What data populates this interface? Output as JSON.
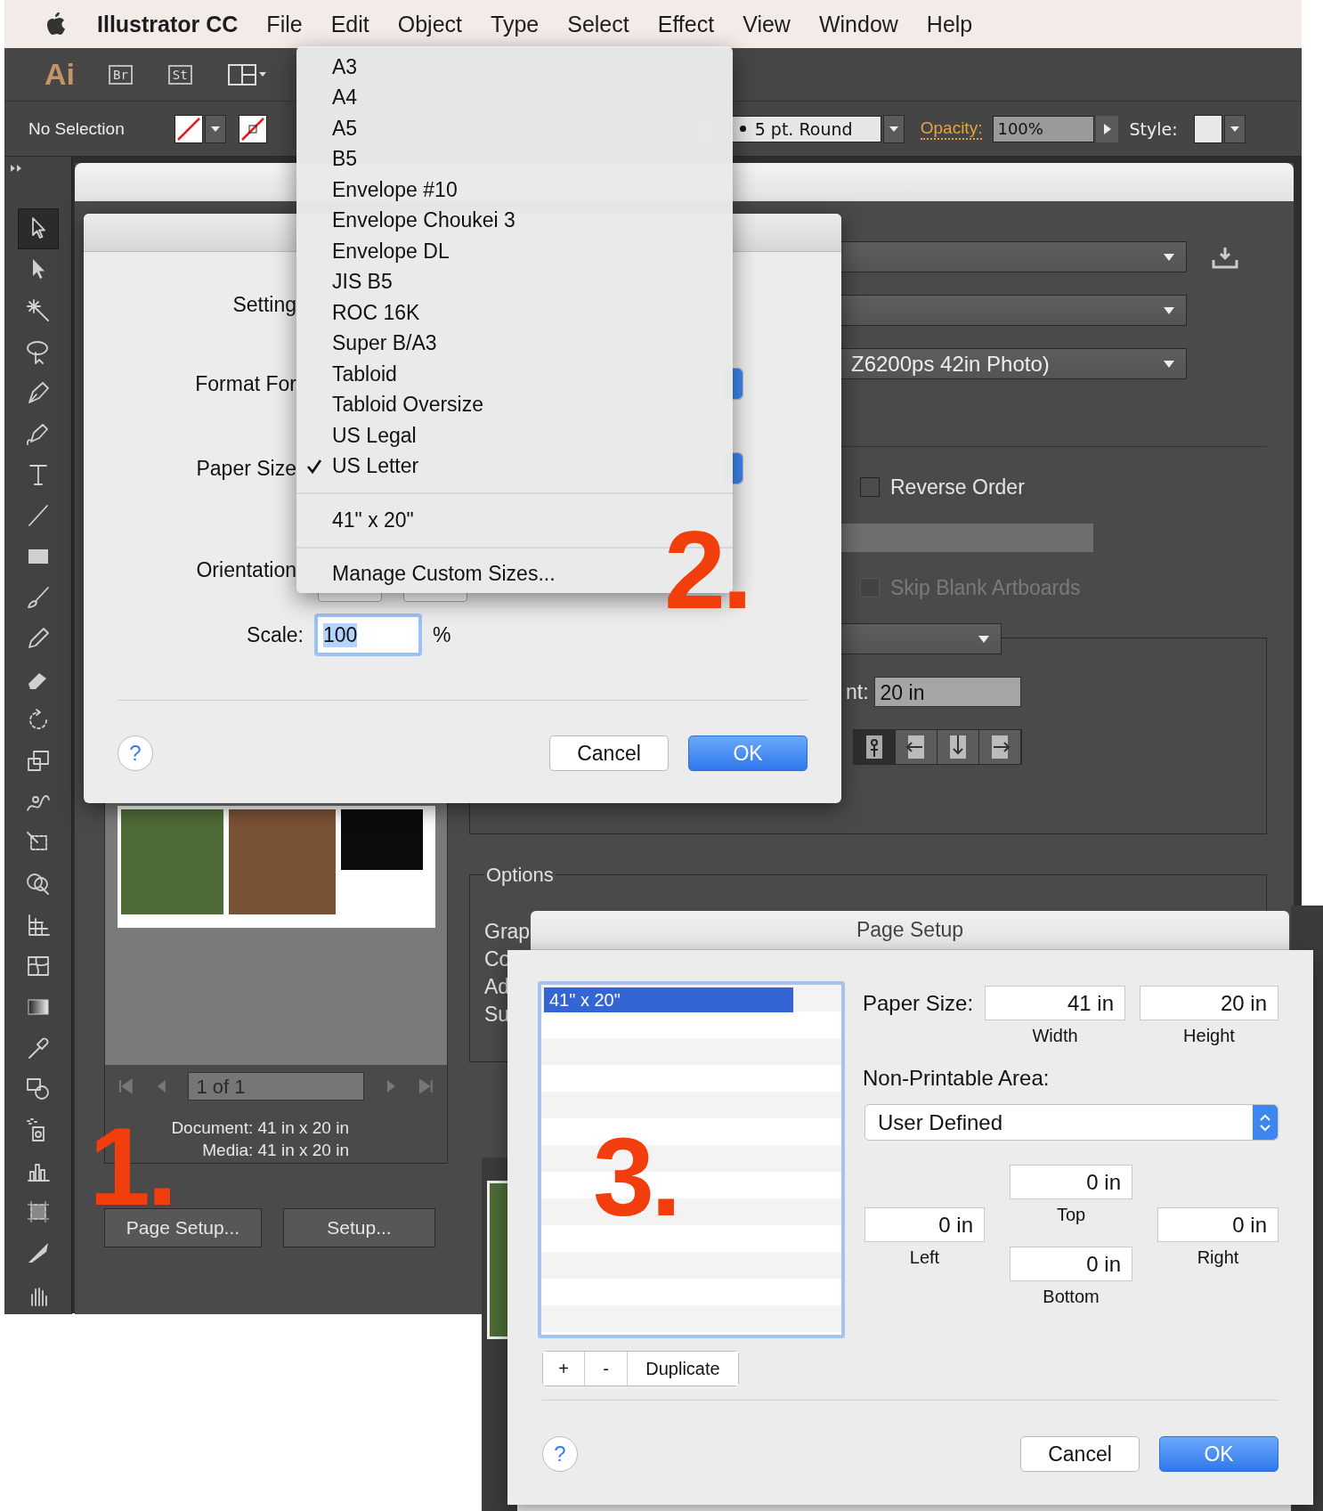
{
  "menu_bar": {
    "app_name": "Illustrator CC",
    "items": [
      "File",
      "Edit",
      "Object",
      "Type",
      "Select",
      "Effect",
      "View",
      "Window",
      "Help"
    ]
  },
  "app_bar": {
    "logo": "Ai",
    "buttons": [
      "Br",
      "St"
    ]
  },
  "control_bar": {
    "selection": "No Selection",
    "stroke": "5 pt. Round",
    "opacity_label": "Opacity:",
    "opacity": "100%",
    "style_label": "Style:"
  },
  "tools": [
    {
      "selected": true
    },
    {
      "selected": false
    },
    {
      "selected": false
    },
    {
      "selected": false
    },
    {
      "selected": false
    },
    {
      "selected": false
    },
    {
      "selected": false
    },
    {
      "selected": false
    },
    {
      "selected": false
    },
    {
      "selected": false
    },
    {
      "selected": false
    },
    {
      "selected": false
    },
    {
      "selected": false
    },
    {
      "selected": false
    },
    {
      "selected": false
    },
    {
      "selected": false
    },
    {
      "selected": false
    },
    {
      "selected": false
    },
    {
      "selected": false
    },
    {
      "selected": false
    },
    {
      "selected": false
    },
    {
      "selected": false
    },
    {
      "selected": false
    },
    {
      "selected": false
    },
    {
      "selected": false
    },
    {
      "selected": false
    },
    {
      "selected": false
    }
  ],
  "print_panel": {
    "printer_fragment": "Z6200ps 42in Photo)",
    "checkboxes": [
      {
        "label": "Reverse Order",
        "checked": false,
        "disabled": false
      },
      {
        "label": "Skip Blank Artboards",
        "checked": false,
        "disabled": true
      }
    ],
    "height_label": "nt:",
    "height_value": "20 in",
    "placement_buttons": [
      {
        "selected": true
      },
      {
        "selected": false
      },
      {
        "selected": false
      },
      {
        "selected": false
      }
    ],
    "options_title": "Options",
    "options_labels": [
      "Grap",
      "Co",
      "Ad",
      "Su"
    ],
    "page_field": "1 of 1",
    "document_size": "Document: 41 in x 20 in",
    "media_size": "Media: 41 in x 20 in",
    "buttons": [
      "Page Setup...",
      "Setup..."
    ]
  },
  "print_dialog": {
    "labels": [
      "Setting",
      "Format For",
      "Paper Size",
      "Orientation"
    ],
    "scale_label": "Scale:",
    "scale_value": "100",
    "scale_unit": "%",
    "help": "?",
    "buttons": [
      {
        "label": "Cancel",
        "default": false
      },
      {
        "label": "OK",
        "default": true
      }
    ]
  },
  "paper_size_menu": {
    "items": [
      {
        "label": "A3",
        "checked": false
      },
      {
        "label": "A4",
        "checked": false
      },
      {
        "label": "A5",
        "checked": false
      },
      {
        "label": "B5",
        "checked": false
      },
      {
        "label": "Envelope #10",
        "checked": false
      },
      {
        "label": "Envelope Choukei 3",
        "checked": false
      },
      {
        "label": "Envelope DL",
        "checked": false
      },
      {
        "label": "JIS B5",
        "checked": false
      },
      {
        "label": "ROC 16K",
        "checked": false
      },
      {
        "label": "Super B/A3",
        "checked": false
      },
      {
        "label": "Tabloid",
        "checked": false
      },
      {
        "label": "Tabloid Oversize",
        "checked": false
      },
      {
        "label": "US Legal",
        "checked": false
      },
      {
        "label": "US Letter",
        "checked": true
      }
    ],
    "custom_sizes": [
      {
        "label": "41\" x 20\"",
        "checked": false
      }
    ],
    "manage": "Manage Custom Sizes..."
  },
  "page_setup": {
    "title": "Page Setup",
    "sizes": [
      {
        "label": "41\" x 20\"",
        "selected": true
      }
    ],
    "list_buttons": [
      "+",
      "-",
      "Duplicate"
    ],
    "paper_size_label": "Paper Size:",
    "width": "41 in",
    "width_label": "Width",
    "height": "20 in",
    "height_label": "Height",
    "non_printable_label": "Non-Printable Area:",
    "non_printable": "User Defined",
    "margins": {
      "top": "0 in",
      "top_label": "Top",
      "left": "0 in",
      "left_label": "Left",
      "right": "0 in",
      "right_label": "Right",
      "bottom": "0 in",
      "bottom_label": "Bottom"
    },
    "help": "?",
    "buttons": [
      {
        "label": "Cancel",
        "default": false
      },
      {
        "label": "OK",
        "default": true
      }
    ]
  },
  "annotations": [
    "1.",
    "2.",
    "3."
  ]
}
